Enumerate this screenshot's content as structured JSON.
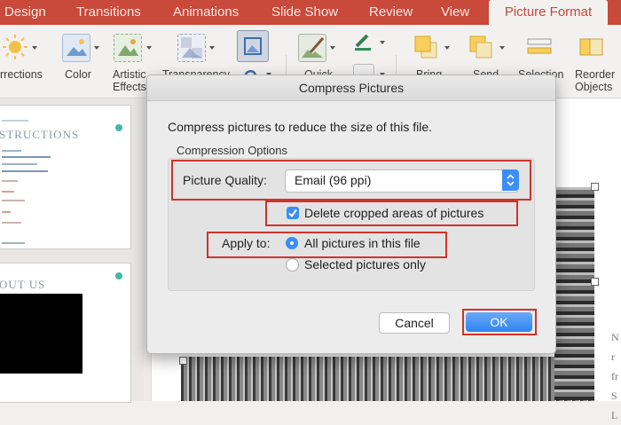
{
  "ribbon": {
    "tabs": [
      {
        "label": "Design"
      },
      {
        "label": "Transitions"
      },
      {
        "label": "Animations"
      },
      {
        "label": "Slide Show"
      },
      {
        "label": "Review"
      },
      {
        "label": "View"
      },
      {
        "label": "Picture Format",
        "active": true
      }
    ],
    "buttons": {
      "corrections": "rrections",
      "color": "Color",
      "artistic_effects": "Artistic\nEffects",
      "transparency": "Transparency",
      "quick_styles": "Quick",
      "bring_forward": "Bring",
      "send_backward": "Send",
      "selection_pane": "Selection",
      "reorder_objects": "Reorder\nObjects"
    },
    "accent_color": "#c9493a"
  },
  "slides": {
    "slide1_title": "STRUCTIONS",
    "slide2_title": "OUT US"
  },
  "canvas": {
    "side_text": [
      "N",
      "r",
      "fr",
      "S",
      "L"
    ]
  },
  "dialog": {
    "title": "Compress Pictures",
    "description": "Compress pictures to reduce the size of this file.",
    "group_label": "Compression Options",
    "picture_quality_label": "Picture Quality:",
    "picture_quality_value": "Email (96 ppi)",
    "delete_cropped_label": "Delete cropped areas of pictures",
    "delete_cropped_checked": true,
    "apply_to_label": "Apply to:",
    "apply_options": [
      {
        "label": "All pictures in this file",
        "selected": true
      },
      {
        "label": "Selected pictures only",
        "selected": false
      }
    ],
    "cancel_label": "Cancel",
    "ok_label": "OK"
  },
  "colors": {
    "highlight_box": "#d0332b",
    "macos_blue": "#3a8ef5"
  }
}
